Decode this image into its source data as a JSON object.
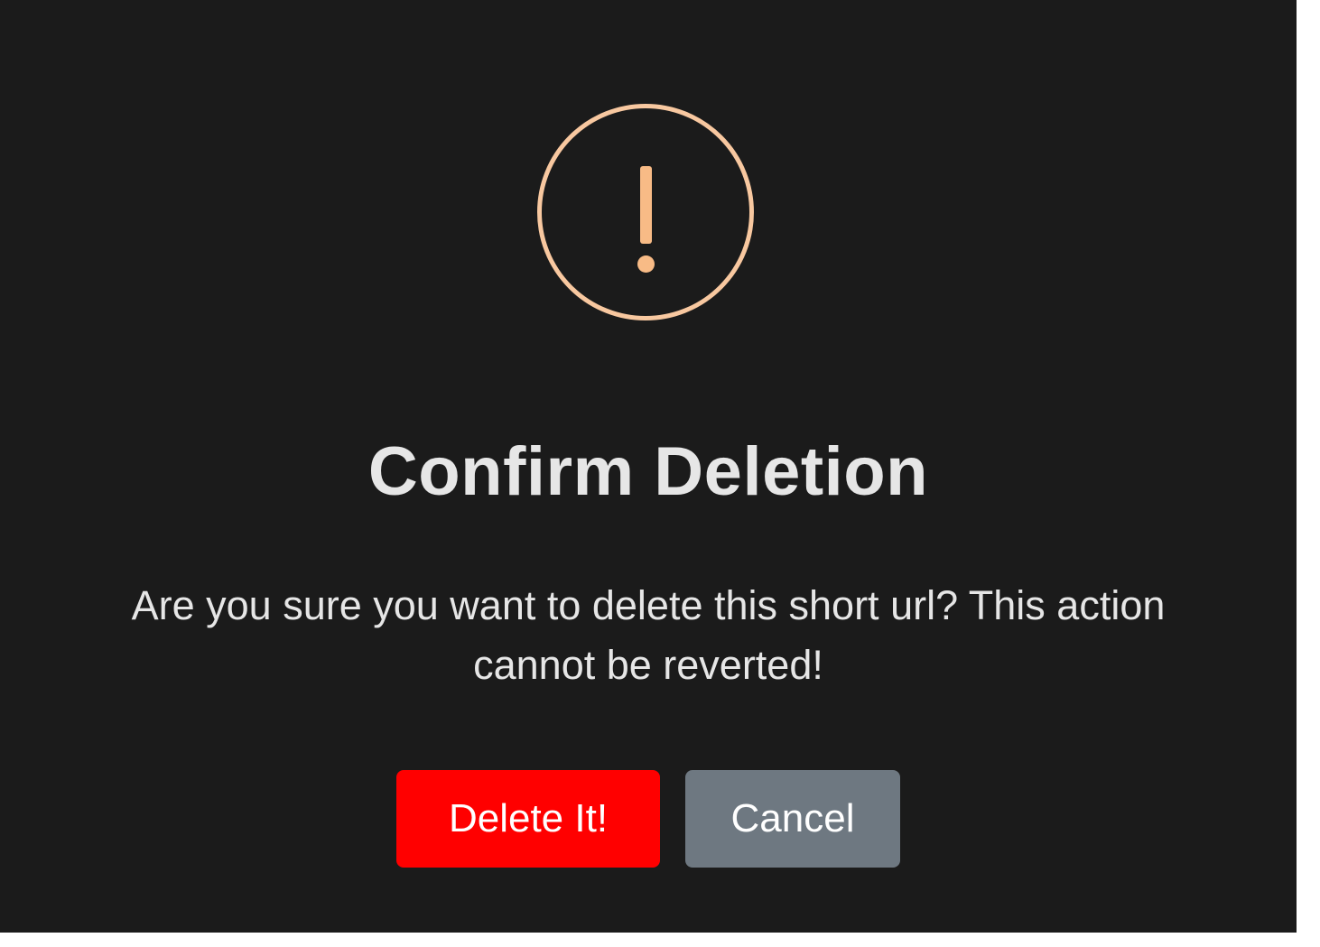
{
  "dialog": {
    "icon": "warning-icon",
    "icon_color": "#f8bb86",
    "title": "Confirm Deletion",
    "message": "Are you sure you want to delete this short url? This action cannot be reverted!",
    "confirm_label": "Delete It!",
    "cancel_label": "Cancel",
    "confirm_color": "#ff0000",
    "cancel_color": "#6e7881",
    "background_color": "#1b1b1b"
  }
}
